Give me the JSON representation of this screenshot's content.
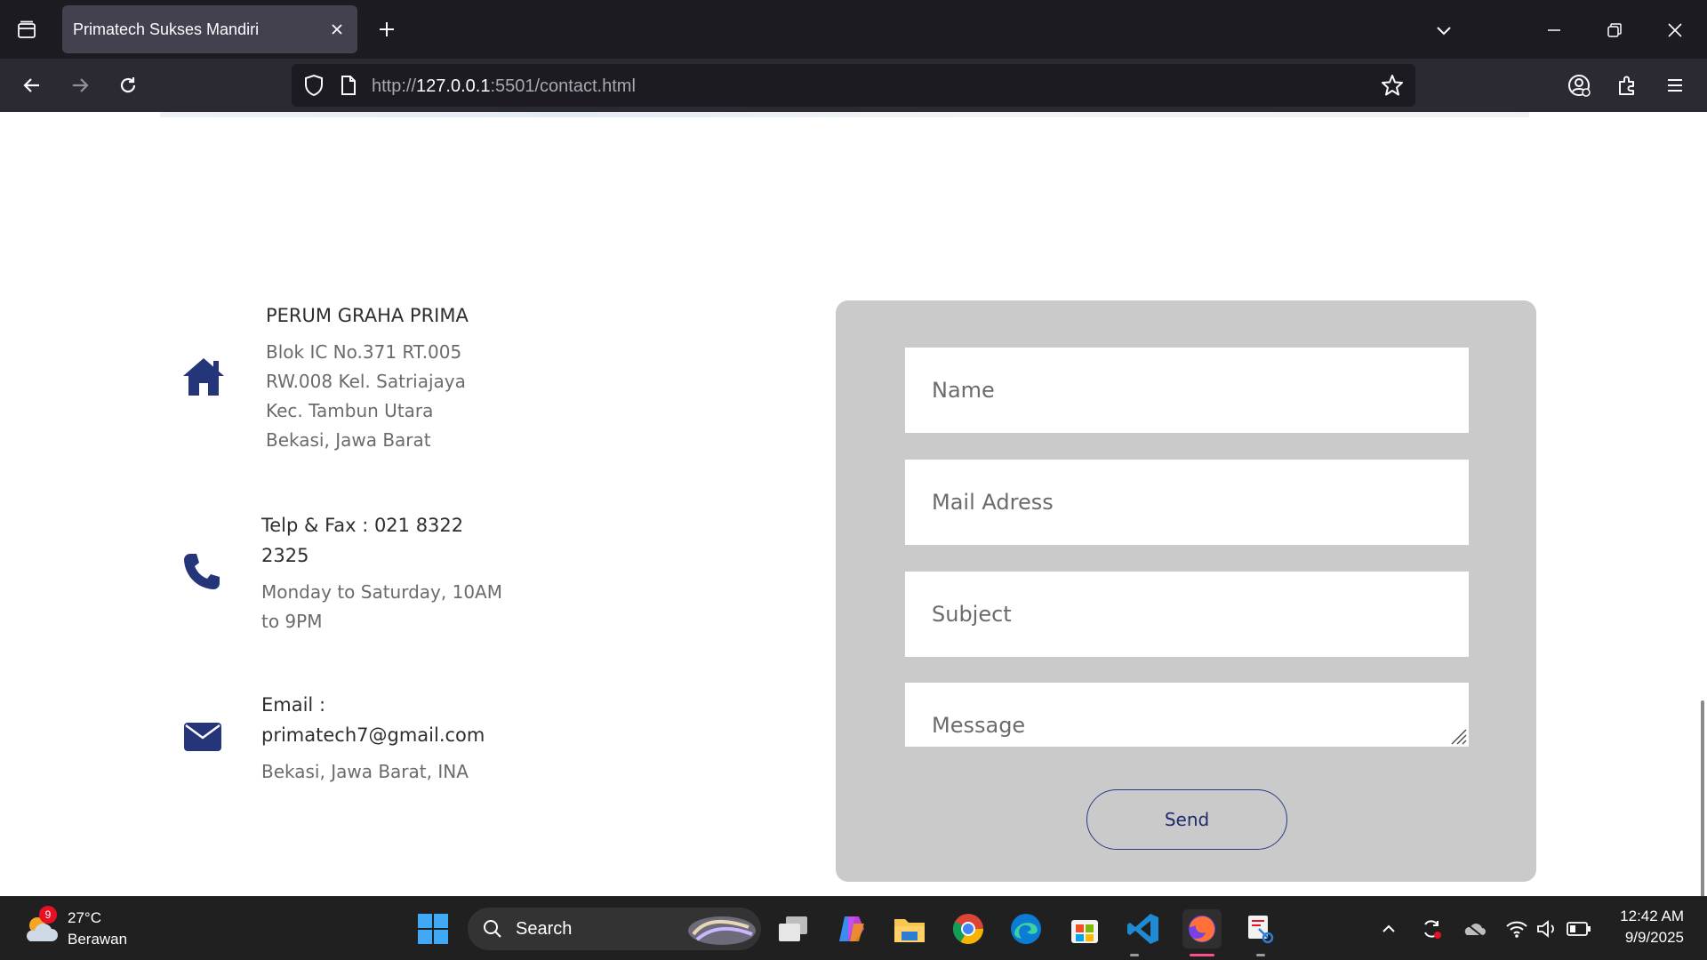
{
  "browser": {
    "tab_title": "Primatech Sukses Mandiri",
    "url_prefix": "http://",
    "url_host": "127.0.0.1",
    "url_rest": ":5501/contact.html"
  },
  "contact": {
    "address": {
      "icon": "home-icon",
      "title": "PERUM GRAHA PRIMA",
      "lines": [
        "Blok IC No.371 RT.005",
        "RW.008 Kel. Satriajaya",
        "Kec. Tambun Utara",
        "Bekasi, Jawa Barat"
      ]
    },
    "phone": {
      "icon": "phone-icon",
      "title_lines": [
        "Telp & Fax : 021 8322",
        "2325"
      ],
      "lines": [
        "Monday to Saturday, 10AM",
        "to 9PM"
      ]
    },
    "email": {
      "icon": "envelope-icon",
      "title_lines": [
        "Email :",
        "primatech7@gmail.com"
      ],
      "lines": [
        "Bekasi, Jawa Barat, INA"
      ]
    }
  },
  "form": {
    "name_placeholder": "Name",
    "mail_placeholder": "Mail Adress",
    "subject_placeholder": "Subject",
    "message_placeholder": "Message",
    "send_label": "Send"
  },
  "taskbar": {
    "weather_temp": "27°C",
    "weather_desc": "Berawan",
    "weather_badge": "9",
    "search_label": "Search",
    "time": "12:42 AM",
    "date": "9/9/2025"
  },
  "colors": {
    "accent": "#2a3a8a",
    "icon_navy": "#24357a",
    "form_bg": "#cacaca"
  }
}
